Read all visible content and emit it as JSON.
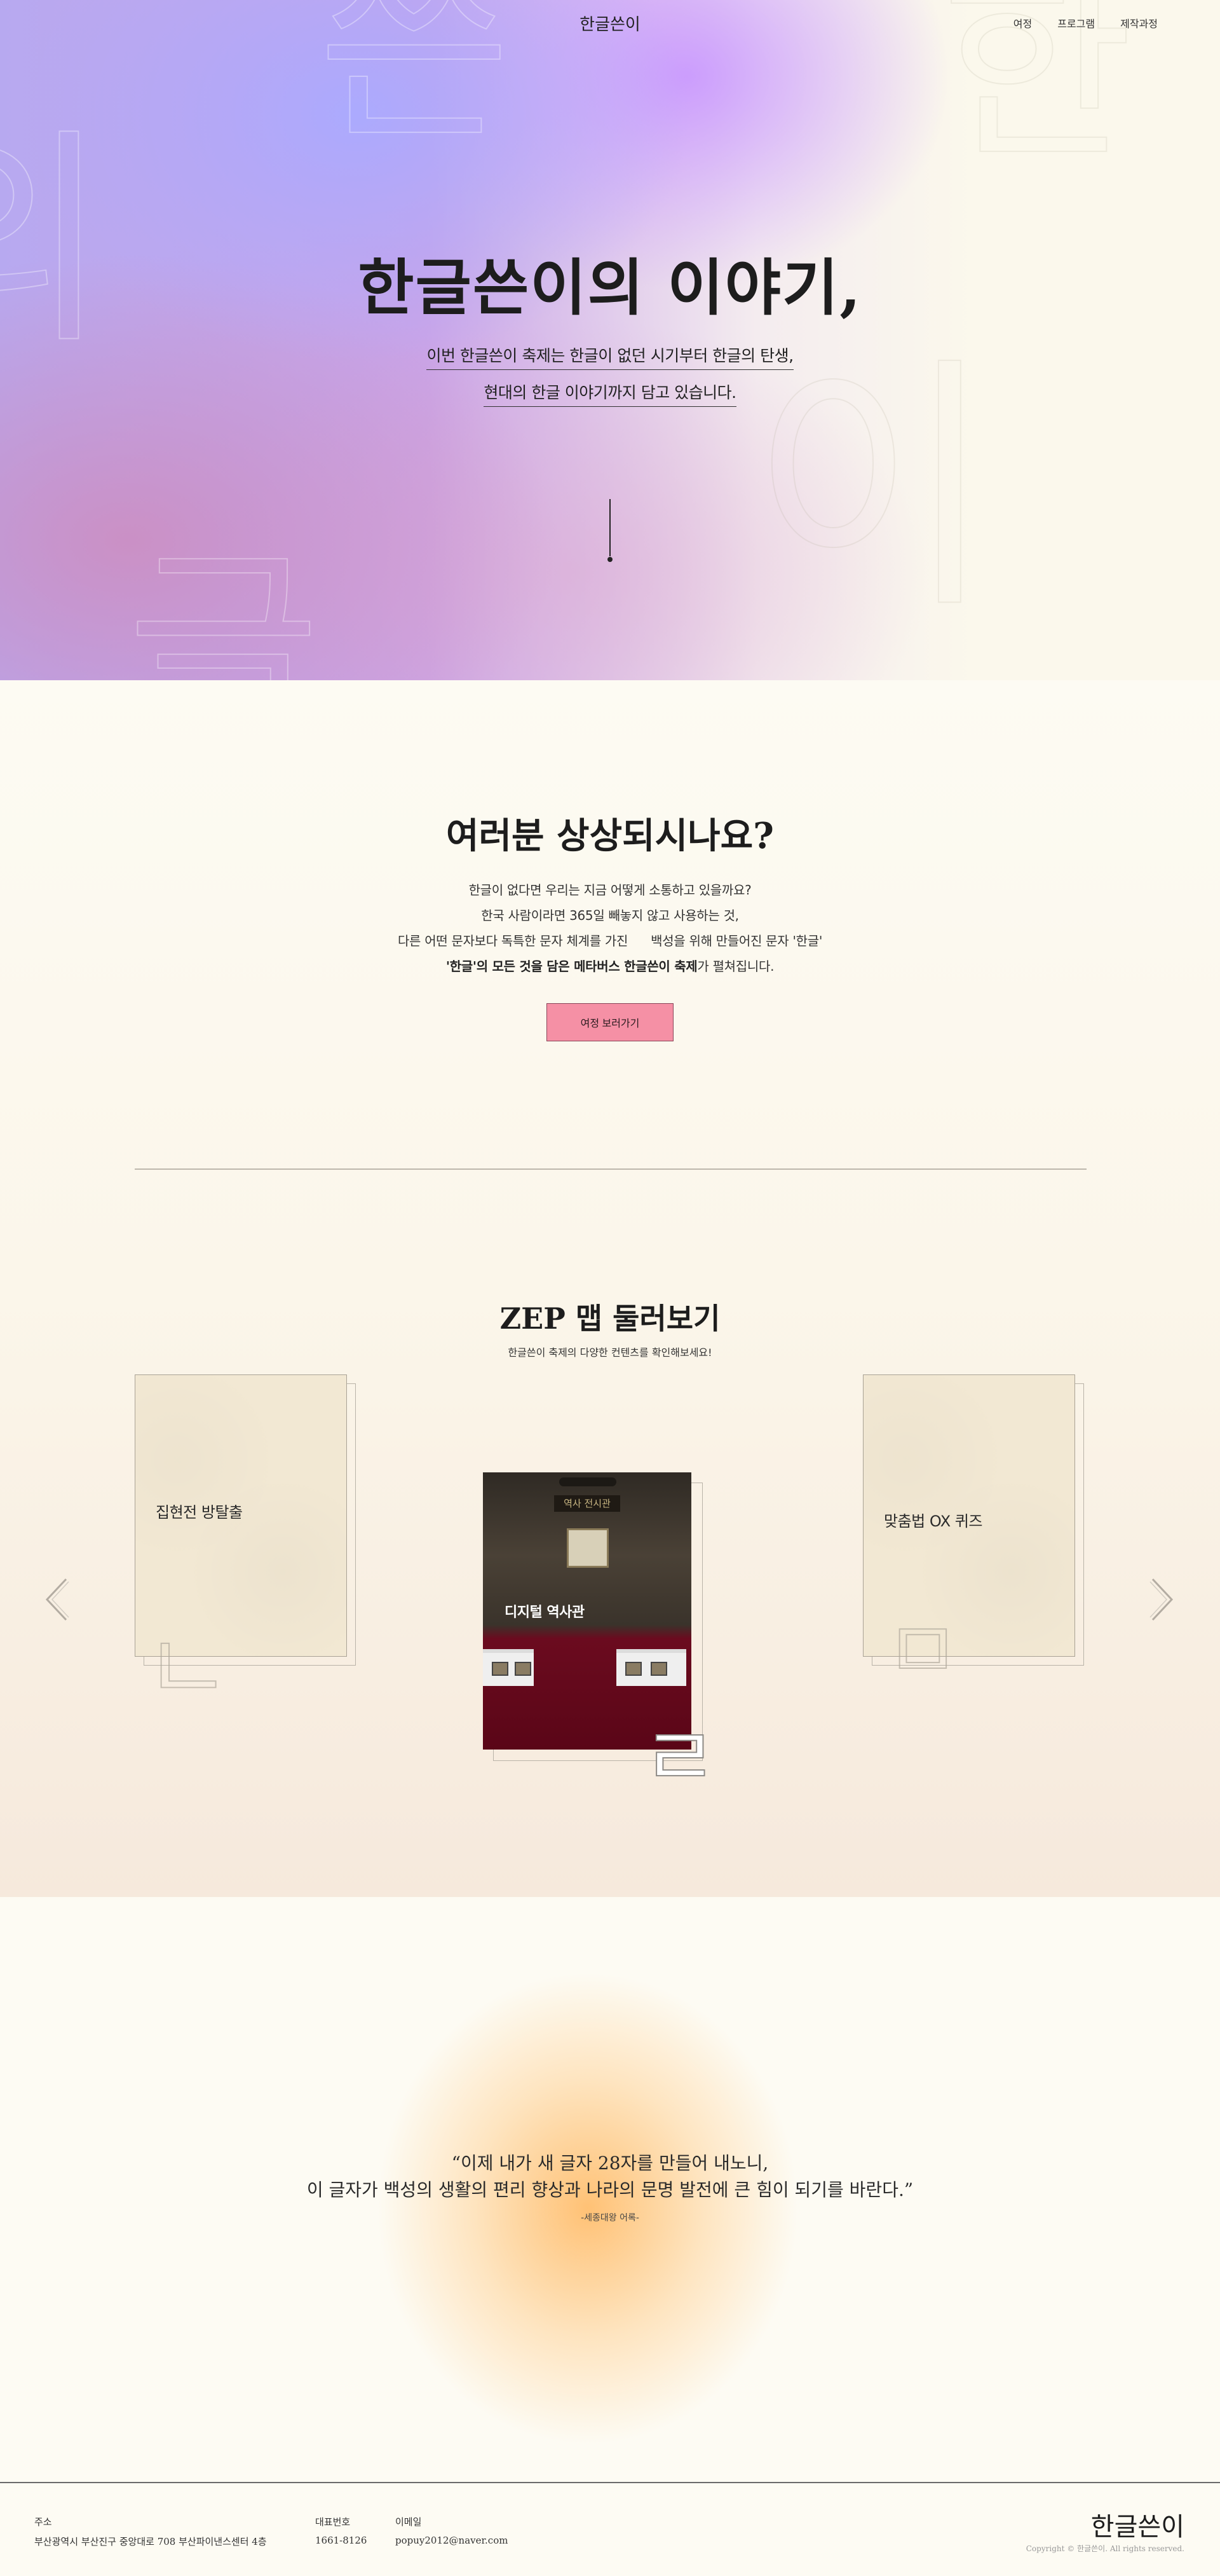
{
  "nav": {
    "logo": "한글쓴이",
    "links": [
      "여정",
      "프로그램",
      "제작과정"
    ]
  },
  "hero": {
    "title": "한글쓴이의 이야기,",
    "subtitle_line1": "이번 한글쓴이 축제는 한글이 없던 시기부터 한글의 탄생,",
    "subtitle_line2": "현대의 한글 이야기까지 담고 있습니다.",
    "ghost_letters": [
      "쓴",
      "한",
      "의",
      "이",
      "글"
    ]
  },
  "imagine": {
    "title_pre": "여러분 ",
    "title_bold": "상상",
    "title_post": "되시나요?",
    "line1": "한글이 없다면 우리는 지금 어떻게 소통하고 있을까요?",
    "line2": "한국 사람이라면 365일 빼놓지 않고 사용하는 것,",
    "line3a": "다른 어떤 문자보다 독특한 문자 체계를 가진",
    "line3b": "백성을 위해 만들어진 문자 '한글'",
    "line4_bold": "'한글'의 모든 것을 담은 메타버스 한글쓴이 축제",
    "line4_post": "가 펼쳐집니다.",
    "button": "여정 보러가기"
  },
  "zep": {
    "title": "ZEP 맵 둘러보기",
    "subtitle": "한글쓴이 축제의 다양한 컨텐츠를 확인해보세요!",
    "cards": [
      {
        "label": "집현전 방탈출",
        "deco": "ㄴ"
      },
      {
        "label": "디지털 역사관",
        "deco": "ㄹ",
        "sign": "역사 전시관"
      },
      {
        "label": "맞춤법 OX 퀴즈",
        "deco": "ㅁ"
      }
    ],
    "prev_icon": "chevron-left-icon",
    "next_icon": "chevron-right-icon"
  },
  "quote": {
    "line1": "“이제 내가 새 글자 28자를 만들어 내노니,",
    "line2": "이 글자가 백성의 생활의 편리 향상과 나라의 문명 발전에 큰 힘이 되기를 바란다.”",
    "author": "-세종대왕 어록-"
  },
  "footer": {
    "address_label": "주소",
    "address": "부산광역시 부산진구 중앙대로 708 부산파이낸스센터 4층",
    "phone_label": "대표번호",
    "phone": "1661-8126",
    "email_label": "이메일",
    "email": "popuy2012@naver.com",
    "logo": "한글쓴이",
    "copyright": "Copyright © 한글쓴이. All rights reserved."
  },
  "colors": {
    "button_pink": "#f590a5",
    "hero_violet": "#b7a9f0",
    "quote_orange": "#ffbe6e"
  }
}
